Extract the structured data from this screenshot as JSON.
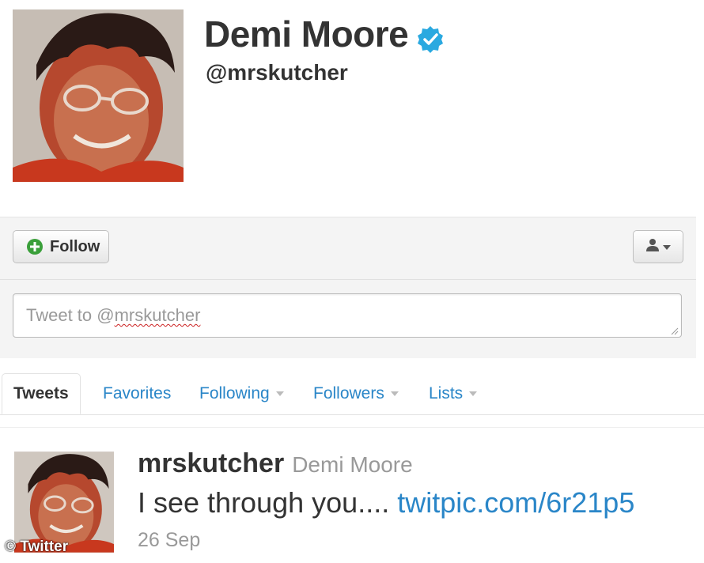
{
  "profile": {
    "display_name": "Demi Moore",
    "screen_name": "@mrskutcher",
    "verified": true,
    "avatar_icon": "child-portrait-photo"
  },
  "actions": {
    "follow_label": "Follow",
    "follow_icon": "plus-circle-icon",
    "user_menu_icon": "person-dropdown-icon"
  },
  "tweet_box": {
    "placeholder_prefix": "Tweet to @",
    "placeholder_handle": "mrskutcher"
  },
  "tabs": [
    {
      "label": "Tweets",
      "active": true
    },
    {
      "label": "Favorites",
      "active": false
    },
    {
      "label": "Following",
      "active": false,
      "dropdown": true
    },
    {
      "label": "Followers",
      "active": false,
      "dropdown": true
    },
    {
      "label": "Lists",
      "active": false,
      "dropdown": true
    }
  ],
  "tweet": {
    "screen_name": "mrskutcher",
    "full_name": "Demi Moore",
    "text": "I see through you....",
    "link": "twitpic.com/6r21p5",
    "time": "26 Sep"
  },
  "watermark": "© Twitter",
  "colors": {
    "link": "#2a86c8",
    "verified": "#2aa9e0",
    "follow_plus": "#3a9f3a"
  }
}
